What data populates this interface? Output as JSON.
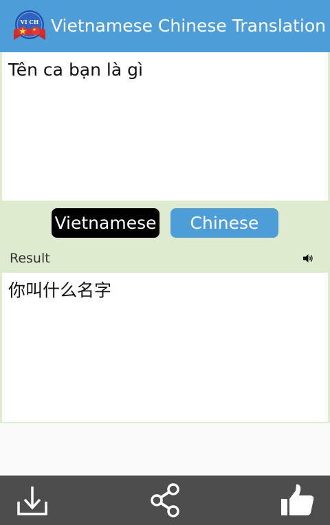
{
  "app": {
    "title": "Vietnamese Chinese Translation",
    "logo_text": "VI CH",
    "logo_icon": "flag-badge-logo"
  },
  "colors": {
    "primary": "#4d9dd8",
    "active_button": "#000000",
    "panel_background": "#dfebcf",
    "bottom_bar": "#4d4d4d"
  },
  "input": {
    "text": "Tên ca bạn là gì"
  },
  "languages": {
    "source": "Vietnamese",
    "target": "Chinese",
    "selected": "Vietnamese"
  },
  "result": {
    "label": "Result",
    "text": "你叫什么名字",
    "speak_icon": "speaker-icon"
  },
  "bottom_bar": {
    "icons": [
      "download-icon",
      "share-icon",
      "thumbs-up-icon"
    ]
  }
}
